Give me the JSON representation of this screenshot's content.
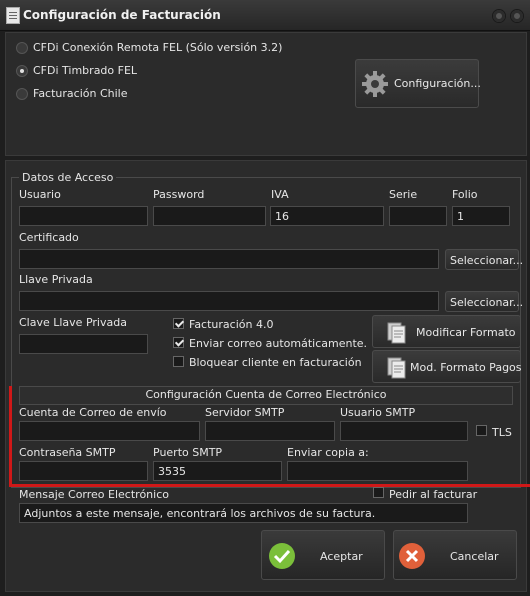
{
  "window": {
    "title": "Configuración de Facturación"
  },
  "options": {
    "items": [
      {
        "label": "CFDi Conexión Remota FEL (Sólo versión 3.2)",
        "selected": false
      },
      {
        "label": "CFDi Timbrado FEL",
        "selected": true
      },
      {
        "label": "Facturación Chile",
        "selected": false
      }
    ],
    "config_button": "Configuración..."
  },
  "access": {
    "group_title": "Datos de Acceso",
    "usuario_label": "Usuario",
    "password_label": "Password",
    "iva_label": "IVA",
    "iva_value": "16",
    "serie_label": "Serie",
    "folio_label": "Folio",
    "folio_value": "1",
    "certificado_label": "Certificado",
    "llave_label": "Llave Privada",
    "clave_label": "Clave Llave Privada",
    "select_button": "Seleccionar...",
    "check_fact40": "Facturación 4.0",
    "check_enviar": "Enviar correo automáticamente.",
    "check_bloquear": "Bloquear cliente en facturación",
    "modificar_formato": "Modificar Formato",
    "mod_formato_pagos": "Mod. Formato Pagos"
  },
  "email": {
    "section_title": "Configuración Cuenta de Correo Electrónico",
    "cuenta_label": "Cuenta de Correo de envío",
    "servidor_label": "Servidor SMTP",
    "usuario_label": "Usuario SMTP",
    "tls_label": "TLS",
    "contrasena_label": "Contraseña SMTP",
    "puerto_label": "Puerto SMTP",
    "puerto_value": "3535",
    "copia_label": "Enviar copia a:",
    "mensaje_label": "Mensaje Correo Electrónico",
    "pedir_label": "Pedir al facturar",
    "mensaje_value": "Adjuntos a este mensaje, encontrará los archivos de su factura."
  },
  "actions": {
    "accept": "Aceptar",
    "cancel": "Cancelar"
  },
  "colors": {
    "highlight": "#d01818",
    "accept_icon": "#7bbf3a",
    "cancel_icon": "#e0603a"
  }
}
